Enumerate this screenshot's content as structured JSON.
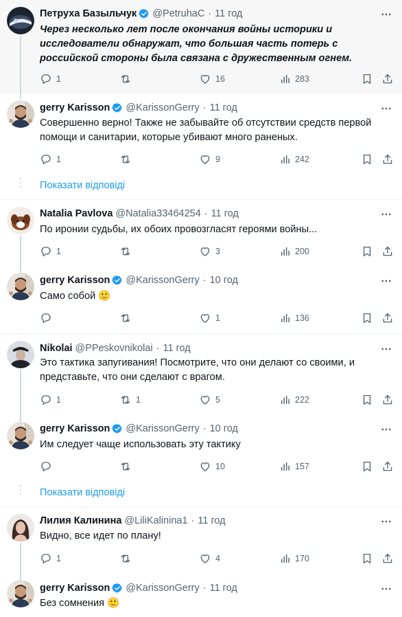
{
  "colors": {
    "link": "#1d9bf0",
    "verified": "#1d9bf0",
    "muted": "#536471",
    "highlight_bg": "#f7f7f7"
  },
  "icons": {
    "reply": "reply-icon",
    "retweet": "retweet-icon",
    "like": "heart-icon",
    "views": "views-icon",
    "bookmark": "bookmark-icon",
    "share": "share-icon",
    "more": "more-icon",
    "verified": "verified-badge-icon"
  },
  "show_replies_label": "Показати відповіді",
  "tweets": [
    {
      "name": "Петруха Базыльчук",
      "verified": true,
      "handle": "@PetruhaC",
      "time": "11 год",
      "text": "Через несколько лет после окончания войны историки и исследователи обнаружат, что большая часть потерь с российской стороны была связана с дружественным огнем.",
      "replies": "1",
      "retweets": "",
      "likes": "16",
      "views": "283"
    },
    {
      "name": "gerry Karisson",
      "verified": true,
      "handle": "@KarissonGerry",
      "time": "11 год",
      "text": "Совершенно верно! Также не забывайте об отсутствии средств первой помощи и санитарии, которые убивают много раненых.",
      "replies": "1",
      "retweets": "",
      "likes": "9",
      "views": "242"
    },
    {
      "name": "Natalia Pavlova",
      "verified": false,
      "handle": "@Natalia33464254",
      "time": "11 год",
      "text": "По иронии судьбы, их обоих провозгласят героями войны...",
      "replies": "1",
      "retweets": "",
      "likes": "3",
      "views": "200"
    },
    {
      "name": "gerry Karisson",
      "verified": true,
      "handle": "@KarissonGerry",
      "time": "10 год",
      "text": "Само собой 🙂",
      "replies": "",
      "retweets": "",
      "likes": "1",
      "views": "136"
    },
    {
      "name": "Nikolai",
      "verified": false,
      "handle": "@PPeskovnikolai",
      "time": "11 год",
      "text": "Это тактика запугивания! Посмотрите, что они делают со своими, и представьте, что они сделают с врагом.",
      "replies": "1",
      "retweets": "1",
      "likes": "5",
      "views": "222"
    },
    {
      "name": "gerry Karisson",
      "verified": true,
      "handle": "@KarissonGerry",
      "time": "10 год",
      "text": "Им следует чаще использовать эту тактику",
      "replies": "",
      "retweets": "",
      "likes": "10",
      "views": "157"
    },
    {
      "name": "Лилия Калинина",
      "verified": false,
      "handle": "@LiliKalinina1",
      "time": "11 год",
      "text": "Видно, все идет по плану!",
      "replies": "1",
      "retweets": "",
      "likes": "4",
      "views": "170"
    },
    {
      "name": "gerry Karisson",
      "verified": true,
      "handle": "@KarissonGerry",
      "time": "11 год",
      "text": "Без сомнения 🙂"
    }
  ]
}
